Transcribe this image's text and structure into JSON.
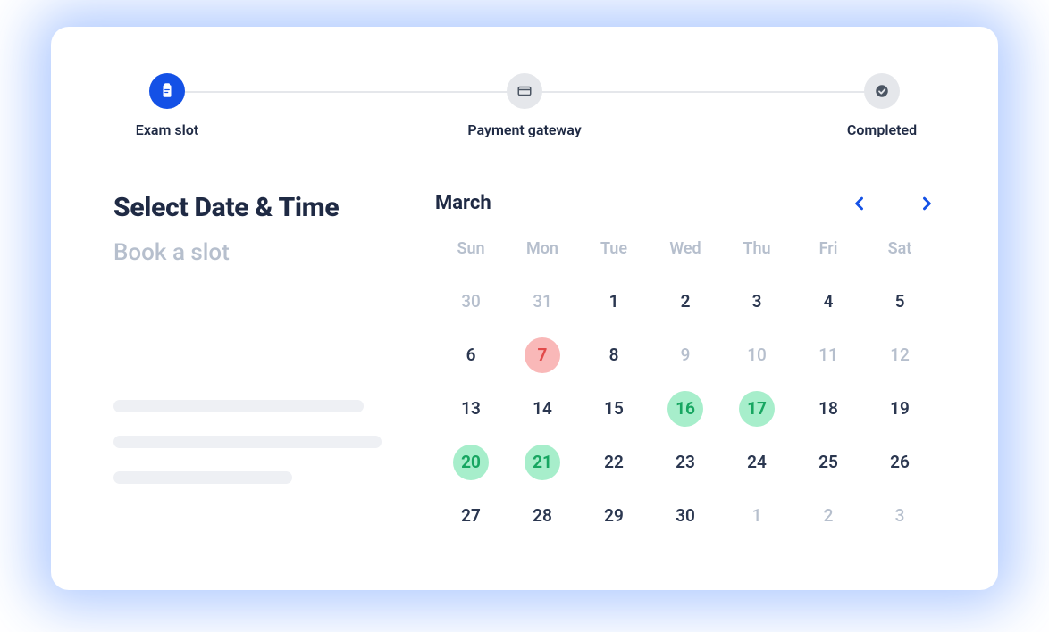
{
  "stepper": {
    "steps": [
      {
        "label": "Exam slot",
        "icon": "clipboard-icon",
        "active": true
      },
      {
        "label": "Payment gateway",
        "icon": "card-icon",
        "active": false
      },
      {
        "label": "Completed",
        "icon": "check-icon",
        "active": false
      }
    ]
  },
  "left": {
    "title": "Select Date & Time",
    "subtitle": "Book a slot"
  },
  "calendar": {
    "month": "March",
    "days_of_week": [
      "Sun",
      "Mon",
      "Tue",
      "Wed",
      "Thu",
      "Fri",
      "Sat"
    ],
    "days": [
      {
        "n": "30",
        "state": "muted"
      },
      {
        "n": "31",
        "state": "muted"
      },
      {
        "n": "1"
      },
      {
        "n": "2"
      },
      {
        "n": "3"
      },
      {
        "n": "4"
      },
      {
        "n": "5"
      },
      {
        "n": "6"
      },
      {
        "n": "7",
        "state": "red"
      },
      {
        "n": "8"
      },
      {
        "n": "9",
        "state": "muted"
      },
      {
        "n": "10",
        "state": "muted"
      },
      {
        "n": "11",
        "state": "muted"
      },
      {
        "n": "12",
        "state": "muted"
      },
      {
        "n": "13"
      },
      {
        "n": "14"
      },
      {
        "n": "15"
      },
      {
        "n": "16",
        "state": "green"
      },
      {
        "n": "17",
        "state": "green"
      },
      {
        "n": "18"
      },
      {
        "n": "19"
      },
      {
        "n": "20",
        "state": "green"
      },
      {
        "n": "21",
        "state": "green"
      },
      {
        "n": "22"
      },
      {
        "n": "23"
      },
      {
        "n": "24"
      },
      {
        "n": "25"
      },
      {
        "n": "26"
      },
      {
        "n": "27"
      },
      {
        "n": "28"
      },
      {
        "n": "29"
      },
      {
        "n": "30"
      },
      {
        "n": "1",
        "state": "muted"
      },
      {
        "n": "2",
        "state": "muted"
      },
      {
        "n": "3",
        "state": "muted"
      }
    ]
  },
  "colors": {
    "accent": "#1451e6",
    "green": "#a7eecb",
    "red": "#f9b8b8",
    "muted": "#b6bfcd",
    "text": "#1f2a44"
  }
}
